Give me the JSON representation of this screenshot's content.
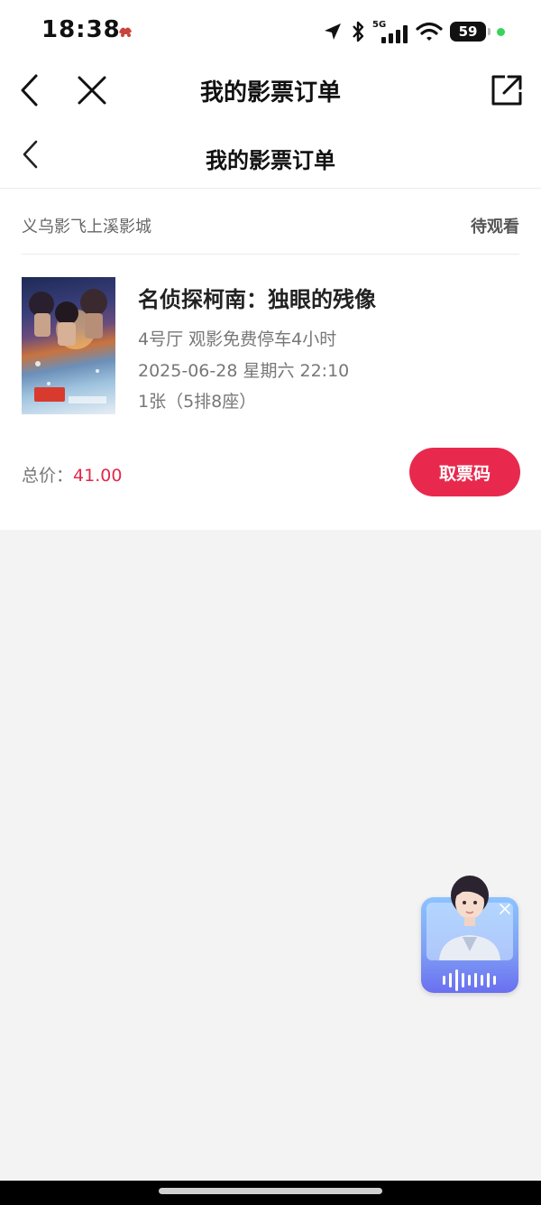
{
  "status_bar": {
    "time": "18:38",
    "network": "5G",
    "battery": "59",
    "icons": [
      "location-arrow-icon",
      "bluetooth-icon",
      "signal-icon",
      "wifi-icon",
      "battery-icon"
    ]
  },
  "outer_nav": {
    "title": "我的影票订单",
    "icons": [
      "back-icon",
      "close-icon",
      "share-icon"
    ]
  },
  "inner_nav": {
    "title": "我的影票订单",
    "icons": [
      "back-icon"
    ]
  },
  "order": {
    "cinema": "义乌影飞上溪影城",
    "status": "待观看",
    "movie_title": "名侦探柯南：独眼的残像",
    "hall": "4号厅 观影免费停车4小时",
    "showtime": "2025-06-28 星期六 22:10",
    "seats": "1张（5排8座）",
    "total_label": "总价：",
    "total_price": "41.00",
    "pickup_button": "取票码"
  },
  "colors": {
    "accent": "#e8294d",
    "price": "#e1294b",
    "background": "#f3f3f3"
  }
}
